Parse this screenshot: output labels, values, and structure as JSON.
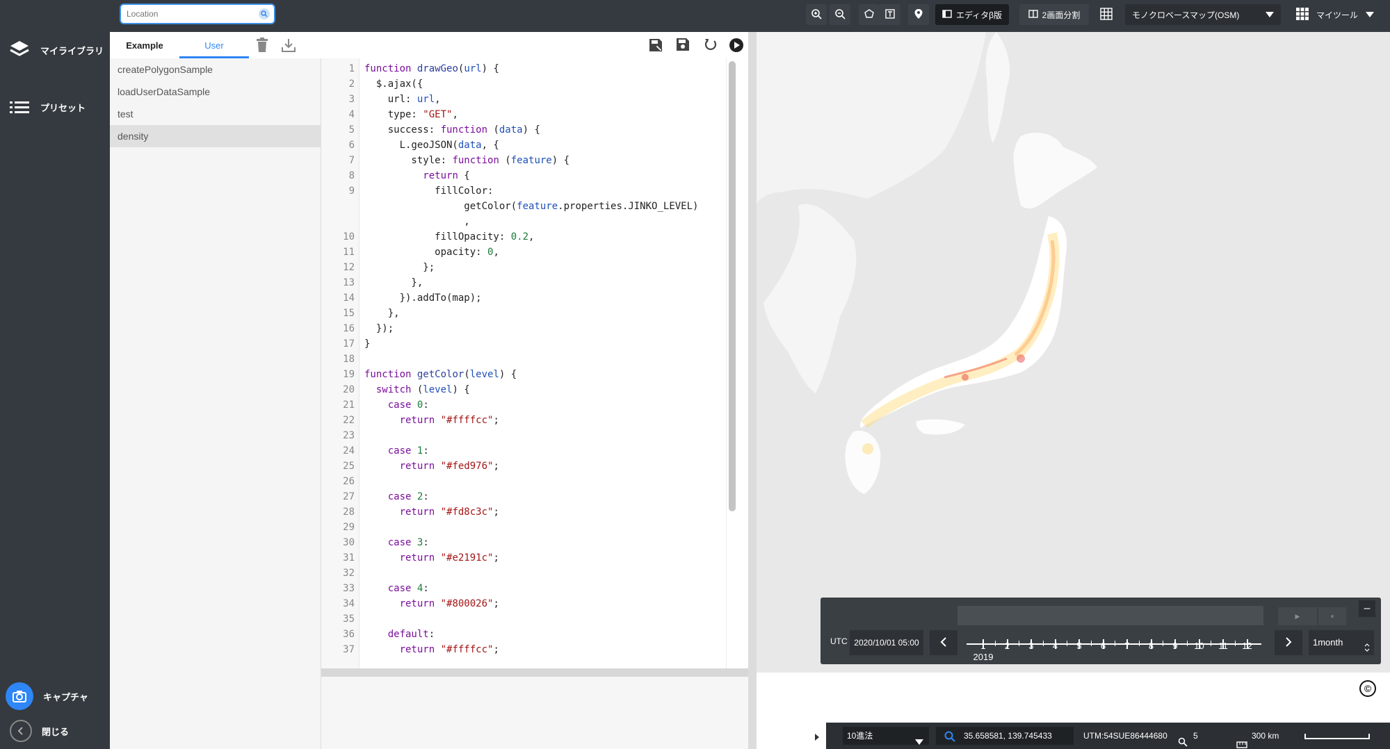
{
  "sidebar": {
    "my_library": "マイライブラリ",
    "preset": "プリセット",
    "capture": "キャプチャ",
    "close": "閉じる"
  },
  "search": {
    "placeholder": "Location"
  },
  "toolbar": {
    "editor_label": "エディタβ版",
    "split_label": "2画面分割",
    "basemap_label": "モノクロベースマップ(OSM)",
    "mytools_label": "マイツール"
  },
  "library": {
    "tabs": [
      "Example",
      "User"
    ],
    "items": [
      "createPolygonSample",
      "loadUserDataSample",
      "test",
      "density"
    ],
    "selected": "density"
  },
  "editor": {
    "line_numbers": [
      "1",
      "2",
      "3",
      "4",
      "5",
      "6",
      "7",
      "8",
      "9",
      "",
      "",
      "10",
      "11",
      "12",
      "13",
      "14",
      "15",
      "16",
      "17",
      "18",
      "19",
      "20",
      "21",
      "22",
      "23",
      "24",
      "25",
      "26",
      "27",
      "28",
      "29",
      "30",
      "31",
      "32",
      "33",
      "34",
      "35",
      "36",
      "37"
    ]
  },
  "timebar": {
    "utc_label": "UTC",
    "date": "2020/10/01 05:00",
    "year": "2019",
    "months": [
      "1",
      "2",
      "3",
      "4",
      "5",
      "6",
      "7",
      "8",
      "9",
      "10",
      "11",
      "12"
    ],
    "interval": "1month",
    "play": "▶",
    "pause": "⏸",
    "minimize": "–"
  },
  "statusbar": {
    "notation": "10進法",
    "coordinates": "35.658581, 139.745433",
    "utm": "UTM:54SUE86444680",
    "zoom": "5",
    "scale": "300 km"
  },
  "map": {
    "copyright_symbol": "©"
  },
  "colors": {
    "sidebar_bg": "#343a3f",
    "accent": "#2f86f6",
    "map_bg": "#e8e8e8",
    "density_0": "#ffffcc",
    "density_1": "#fed976",
    "density_2": "#fd8c3c",
    "density_3": "#e2191c",
    "density_4": "#800026"
  }
}
